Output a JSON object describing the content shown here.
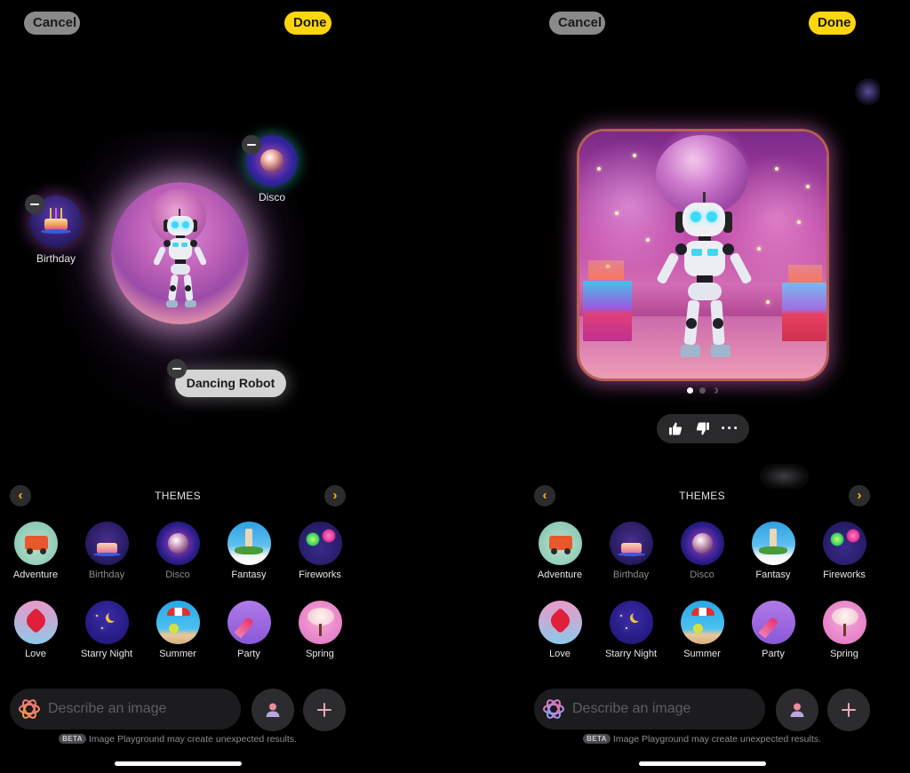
{
  "screens": [
    {
      "id": "compose",
      "header": {
        "cancel_label": "Cancel",
        "done_label": "Done"
      },
      "canvas": {
        "concept_bubbles": [
          {
            "label": "Birthday",
            "type": "theme",
            "remove_icon": "minus-icon"
          },
          {
            "label": "Disco",
            "type": "theme",
            "remove_icon": "minus-icon"
          }
        ],
        "prompt_chip": {
          "label": "Dancing Robot",
          "remove_icon": "minus-icon"
        },
        "preview_bubble": {
          "subject": "Dancing Robot"
        }
      }
    },
    {
      "id": "result",
      "header": {
        "cancel_label": "Cancel",
        "done_label": "Done"
      },
      "preview": {
        "subject": "Dancing Robot",
        "page_count": 3,
        "current_page": 1,
        "loading_page": 3
      },
      "feedback": {
        "thumbs_up_icon": "thumbs-up-icon",
        "thumbs_down_icon": "thumbs-down-icon",
        "more_label": "···"
      }
    }
  ],
  "themes": {
    "title": "THEMES",
    "prev_icon": "chevron-left-icon",
    "next_icon": "chevron-right-icon",
    "prev_glyph": "‹",
    "next_glyph": "›",
    "items": [
      {
        "label": "Adventure",
        "selected": false
      },
      {
        "label": "Birthday",
        "selected": true
      },
      {
        "label": "Disco",
        "selected": true
      },
      {
        "label": "Fantasy",
        "selected": false
      },
      {
        "label": "Fireworks",
        "selected": false
      },
      {
        "label": "Love",
        "selected": false
      },
      {
        "label": "Starry Night",
        "selected": false
      },
      {
        "label": "Summer",
        "selected": false
      },
      {
        "label": "Party",
        "selected": false
      },
      {
        "label": "Spring",
        "selected": false
      }
    ]
  },
  "input": {
    "placeholder": "Describe an image",
    "value": "",
    "person_icon": "person-icon",
    "plus_icon": "plus-icon"
  },
  "footer": {
    "beta_badge": "BETA",
    "disclaimer": "Image Playground may create unexpected results."
  },
  "colors": {
    "accent_yellow": "#ffd60a",
    "cancel_gray": "#8a8a8a",
    "chevron_yellow": "#f2c10e",
    "input_bg": "#1c1c1e",
    "circle_button_bg": "#2c2c2e"
  }
}
